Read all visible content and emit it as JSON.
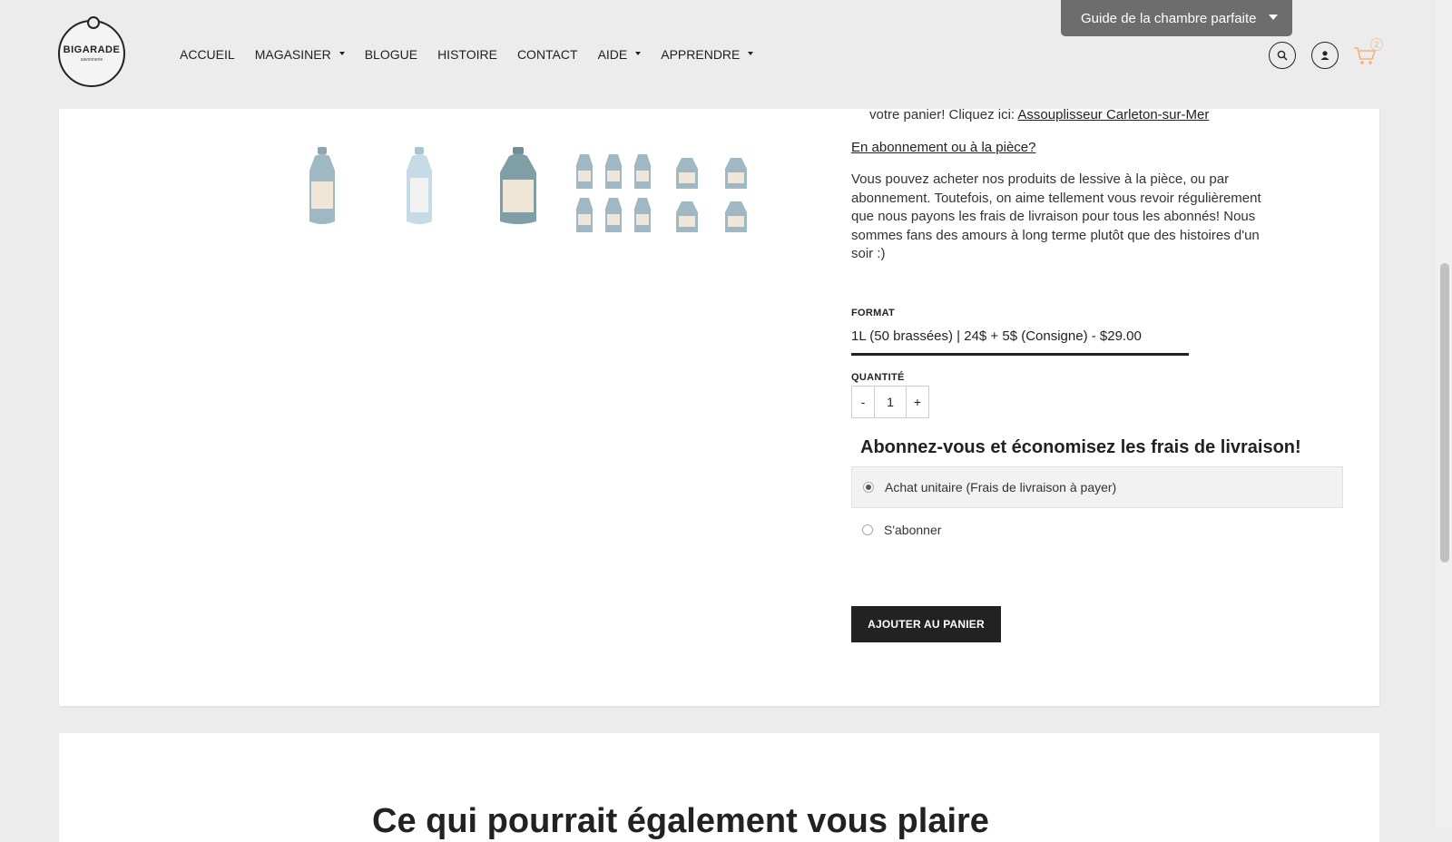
{
  "header": {
    "logo": {
      "brand": "BIGARADE",
      "sub": "savonnerie"
    },
    "nav": [
      {
        "label": "ACCUEIL",
        "dropdown": false
      },
      {
        "label": "MAGASINER",
        "dropdown": true
      },
      {
        "label": "BLOGUE",
        "dropdown": false
      },
      {
        "label": "HISTOIRE",
        "dropdown": false
      },
      {
        "label": "CONTACT",
        "dropdown": false
      },
      {
        "label": "AIDE",
        "dropdown": true
      },
      {
        "label": "APPRENDRE",
        "dropdown": true
      }
    ],
    "guide_button": "Guide de la chambre parfaite",
    "cart_count": "2",
    "icons": {
      "search": "search-icon",
      "account": "user-icon",
      "cart": "cart-icon"
    }
  },
  "product": {
    "promo_text": "votre panier! Cliquez ici:",
    "promo_link": "Assouplisseur Carleton-sur-Mer",
    "subscription_link": "En abonnement ou à la pièce?",
    "description": "Vous pouvez acheter nos produits de lessive à la pièce, ou par abonnement. Toutefois, on aime tellement vous revoir régulièrement que nous payons les frais de livraison pour tous les abonnés! Nous sommes fans des amours à long terme plutôt que des histoires d'un soir :)",
    "format_label": "FORMAT",
    "format_value": "1L (50 brassées) | 24$ + 5$ (Consigne) - $29.00",
    "quantity_label": "QUANTITÉ",
    "quantity_minus": "-",
    "quantity_value": "1",
    "quantity_plus": "+",
    "subscribe_title": "Abonnez-vous et économisez les frais de livraison!",
    "options": [
      {
        "label": "Achat unitaire (Frais de livraison à payer)",
        "selected": true
      },
      {
        "label": "S'abonner",
        "selected": false
      }
    ],
    "add_to_cart": "AJOUTER AU PANIER"
  },
  "related": {
    "title": "Ce qui pourrait également vous plaire"
  },
  "colors": {
    "accent": "#222222",
    "guide_bg": "#6d6d6d",
    "bottle": "#9fb8c4",
    "label": "#efe6d8"
  }
}
